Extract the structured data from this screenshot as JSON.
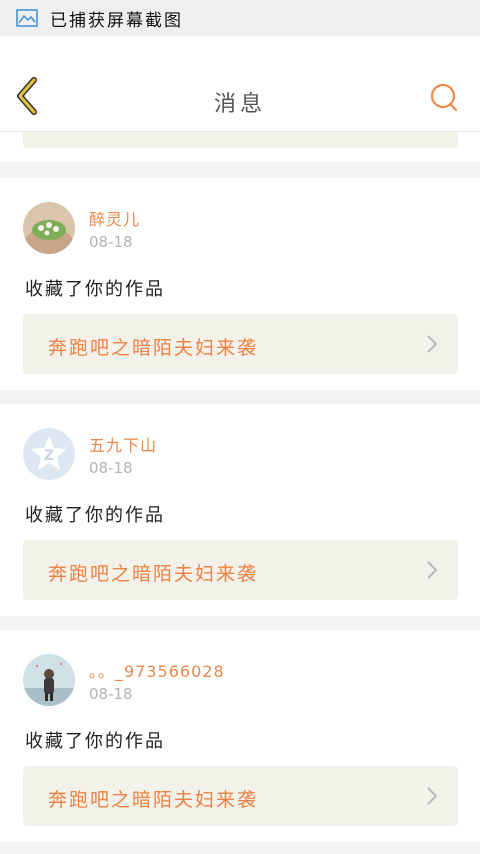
{
  "status_bar": {
    "text": "已捕获屏幕截图",
    "icon": "screenshot-icon"
  },
  "header": {
    "title": "消息",
    "back_icon": "chevron-left-icon",
    "search_icon": "search-icon"
  },
  "colors": {
    "accent": "#e8884c",
    "link_bg": "#f3f2ea",
    "back_arrow": "#e5c43a"
  },
  "messages": [
    {
      "username": "醉灵儿",
      "date": "08-18",
      "action": "收藏了你的作品",
      "work_title": "奔跑吧之暗陌夫妇来袭",
      "avatar": "plant-avatar"
    },
    {
      "username": "五九下山",
      "date": "08-18",
      "action": "收藏了你的作品",
      "work_title": "奔跑吧之暗陌夫妇来袭",
      "avatar": "default-z-avatar"
    },
    {
      "username": "。。_973566028",
      "date": "08-18",
      "action": "收藏了你的作品",
      "work_title": "奔跑吧之暗陌夫妇来袭",
      "avatar": "girl-avatar"
    }
  ]
}
